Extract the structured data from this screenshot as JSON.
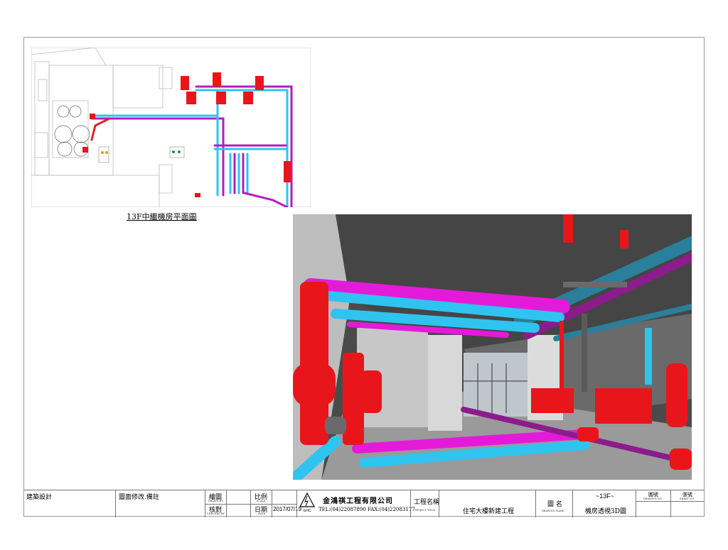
{
  "plan": {
    "title": "13F中繼機房平面圖"
  },
  "titleblock": {
    "architect": "建築設計",
    "revisions": "圖面修改.備註",
    "drawn_by": "繪圖",
    "drawn_by_en": "DRAWN BY",
    "checked_by": "核對",
    "checked_by_en": "CHECKED BY",
    "scale": "比例",
    "scale_en": "SCALE",
    "date_label": "日期",
    "date_label_en": "DATE",
    "date": "2017/07/19",
    "logo_text": "GHC",
    "company": "金鴻祺工程有限公司",
    "tel": "TEL:(04)22087890",
    "fax": "FAX:(04)22083177",
    "project_title_label": "工程名稱",
    "project_title_en": "PROJECT TITLE",
    "project_name": "住宅大樓新建工程",
    "drawing_name_label": "圖 名",
    "drawing_name_en": "DRAWING NAME",
    "floor": "~13F~",
    "drawing_name": "機房透視3D圖",
    "drawing_no_label": "圖號",
    "drawing_no_en": "DRAWING NO.",
    "sheet_no_label": "張號",
    "sheet_no_en": "SHEET NO."
  },
  "colors": {
    "pipe_red": "#e8161b",
    "pipe_cyan": "#2fc3f0",
    "pipe_magenta": "#e31bd9",
    "ceiling": "#474747",
    "floor": "#9c9c9c"
  }
}
